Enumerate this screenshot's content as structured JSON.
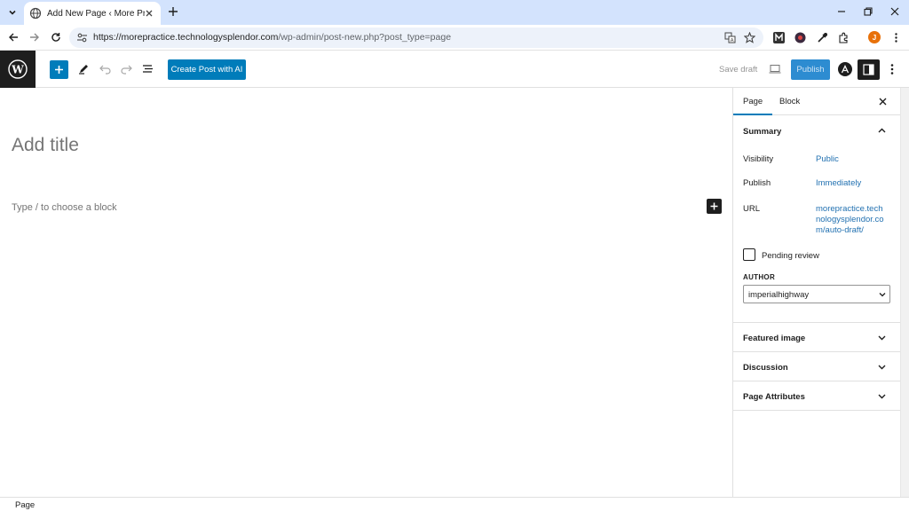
{
  "browser": {
    "tab_title": "Add New Page ‹ More Practice",
    "url_host": "https://morepractice.technologysplendor.com",
    "url_path": "/wp-admin/post-new.php?post_type=page",
    "profile_initial": "J"
  },
  "header": {
    "ai_button_label": "Create Post with AI",
    "save_draft_label": "Save draft",
    "publish_label": "Publish"
  },
  "canvas": {
    "title_placeholder": "Add title",
    "block_placeholder": "Type / to choose a block"
  },
  "sidebar": {
    "tabs": [
      {
        "label": "Page",
        "active": true
      },
      {
        "label": "Block",
        "active": false
      }
    ],
    "summary": {
      "title": "Summary",
      "visibility_label": "Visibility",
      "visibility_value": "Public",
      "publish_label": "Publish",
      "publish_value": "Immediately",
      "url_label": "URL",
      "url_value": "morepractice.technologysplendor.com/auto-draft/",
      "pending_label": "Pending review",
      "author_label": "AUTHOR",
      "author_value": "imperialhighway"
    },
    "panels": [
      {
        "label": "Featured image"
      },
      {
        "label": "Discussion"
      },
      {
        "label": "Page Attributes"
      }
    ]
  },
  "footer": {
    "breadcrumb": "Page"
  },
  "colors": {
    "accent": "#007cba",
    "tabbar": "#d3e3fd",
    "link": "#2271b1"
  }
}
